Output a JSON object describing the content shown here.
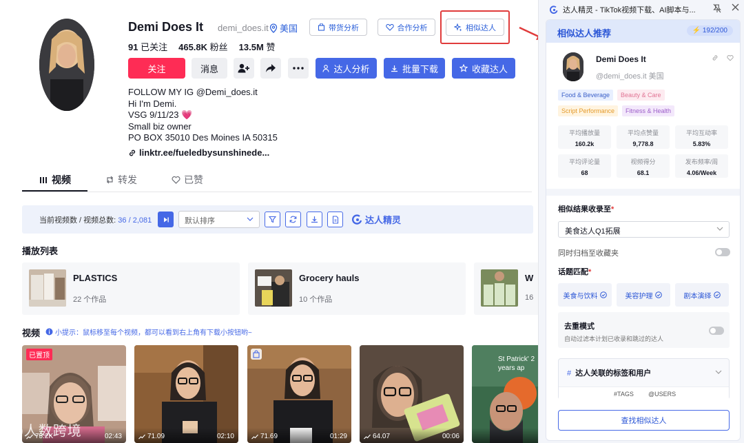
{
  "profile": {
    "name": "Demi Does It",
    "handle": "demi_does.it",
    "location": "美国",
    "btn_goods": "带货分析",
    "btn_coop": "合作分析",
    "btn_similar": "相似达人",
    "following_n": "91",
    "following_l": "已关注",
    "followers_n": "465.8K",
    "followers_l": "粉丝",
    "likes_n": "13.5M",
    "likes_l": "赞",
    "follow": "关注",
    "message": "消息",
    "btn_analysis": "达人分析",
    "btn_download": "批量下载",
    "btn_collect": "收藏达人",
    "bio": [
      "FOLLOW MY IG @Demi_does.it",
      "Hi I'm Demi.",
      "VSG 9/11/23 💗",
      "Small biz owner",
      "PO BOX 35010 Des Moines IA 50315"
    ],
    "link": "linktr.ee/fueledbysunshinede..."
  },
  "tabs": {
    "videos": "视频",
    "reposts": "转发",
    "liked": "已赞"
  },
  "toolbar": {
    "label": "当前视频数 / 视频总数:",
    "count": "36 / 2,081",
    "sort": "默认排序",
    "brand": "达人精灵"
  },
  "playlists": {
    "heading": "播放列表",
    "items": [
      {
        "title": "PLASTICS",
        "count": "22 个作品"
      },
      {
        "title": "Grocery hauls",
        "count": "10 个作品"
      },
      {
        "title": "W",
        "count": "16"
      }
    ]
  },
  "videos": {
    "heading": "视频",
    "tip": "小提示：鼠标移至每个视频，都可以看到右上角有下载小按钮哟~",
    "pinned": "已置顶",
    "items": [
      {
        "views": "75.2K",
        "duration": "02:43"
      },
      {
        "views": "71.09",
        "duration": "02:10"
      },
      {
        "views": "71.69",
        "duration": "01:29"
      },
      {
        "views": "64.07",
        "duration": "00:06"
      },
      {
        "views": "",
        "duration": ""
      }
    ],
    "overlay_text": "St Patrick' 2 years ap"
  },
  "watermark": "(C)人数跨境",
  "panel": {
    "window_title": "达人精灵 - TikTok视频下载、AI脚本与...",
    "title": "相似达人推荐",
    "quota": "192/200",
    "creator_name": "Demi Does It",
    "creator_handle": "@demi_does.it",
    "creator_loc": "美国",
    "tags": [
      "Food & Beverage",
      "Beauty & Care",
      "Script Performance",
      "Fitness & Health"
    ],
    "metrics": [
      {
        "label": "平均播放量",
        "value": "160.2k"
      },
      {
        "label": "平均点赞量",
        "value": "9,778.8"
      },
      {
        "label": "平均互动率",
        "value": "5.83%"
      },
      {
        "label": "平均评论量",
        "value": "68"
      },
      {
        "label": "视频得分",
        "value": "68.1"
      },
      {
        "label": "发布频率/周",
        "value": "4.06/Week"
      }
    ],
    "collect_label": "相似结果收录至",
    "collect_value": "美食达人Q1拓展",
    "archive_label": "同时归档至收藏夹",
    "topic_label": "话题匹配",
    "topics": [
      "美食与饮料",
      "美容护理",
      "剧本演绎"
    ],
    "dedup_title": "去重模式",
    "dedup_desc": "自动过滤本计划已收录和跳过的达人",
    "related_title": "达人关联的标签和用户",
    "related_tags": "#TAGS",
    "related_users": "@USERS",
    "find_btn": "查找相似达人"
  }
}
